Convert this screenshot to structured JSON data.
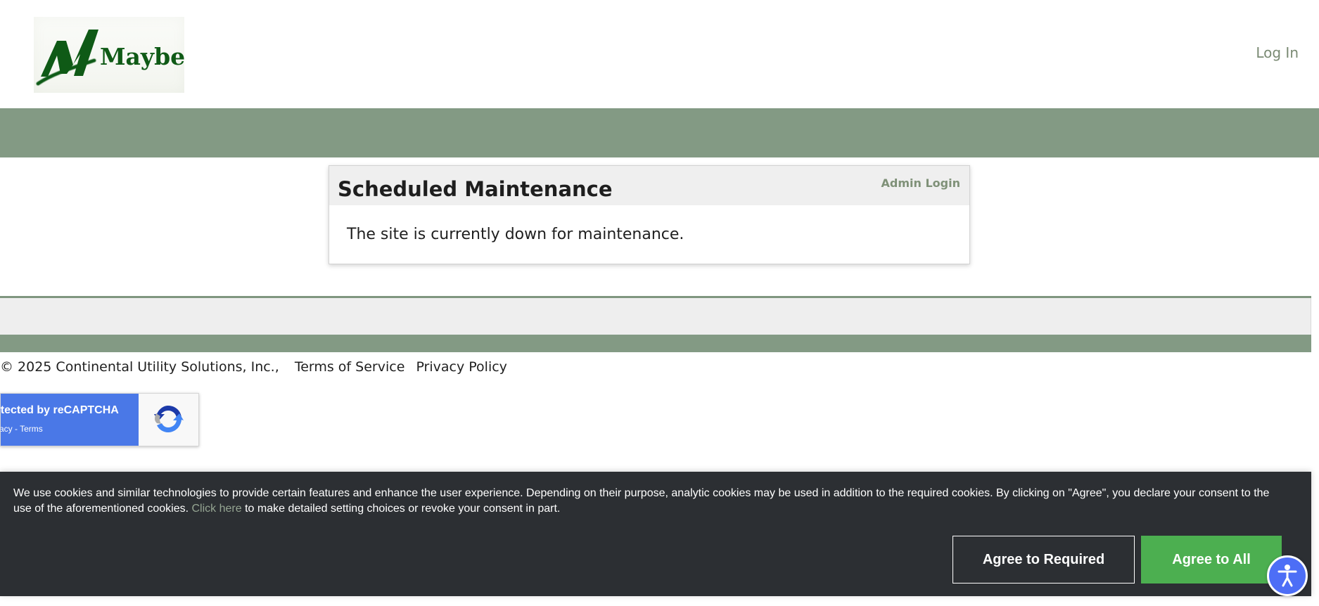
{
  "header": {
    "logo": {
      "icon": "mayberry-logo-icon",
      "text": "Mayberry",
      "accent": "#0f5a16"
    },
    "login_link": "Log In"
  },
  "card": {
    "title": "Scheduled Maintenance",
    "admin_link": "Admin Login",
    "message": "The site is currently down for maintenance."
  },
  "footer": {
    "copyright": "© 2025 Continental Utility Solutions, Inc.,",
    "links": [
      "Terms of Service",
      "Privacy Policy"
    ]
  },
  "recaptcha": {
    "main_text": "otected by reCAPTCHA",
    "sub_text": "vacy - Terms",
    "icon": "recaptcha-icon"
  },
  "cookie_banner": {
    "text_before_link": "We use cookies and similar technologies to provide certain features and enhance the user experience. Depending on their purpose, analytic cookies may be used in addition to the required cookies. By clicking on \"Agree\", you declare your consent to the use of the aforementioned cookies.",
    "link_text": "Click here",
    "text_after_link": "to make detailed setting choices or revoke your consent in part.",
    "buttons": {
      "required": "Agree to Required",
      "all": "Agree to All"
    }
  },
  "accessibility_widget": {
    "icon": "accessibility-icon",
    "color": "#4d6ef6"
  },
  "colors": {
    "header_band": "#839a84",
    "login_text": "#7a8a73",
    "admin_link": "#7f9178",
    "cookie_background": "#2c2f33",
    "cookie_link": "#95a592",
    "agree_all": "#4caf50",
    "recaptcha_blue": "#4a78e7"
  }
}
